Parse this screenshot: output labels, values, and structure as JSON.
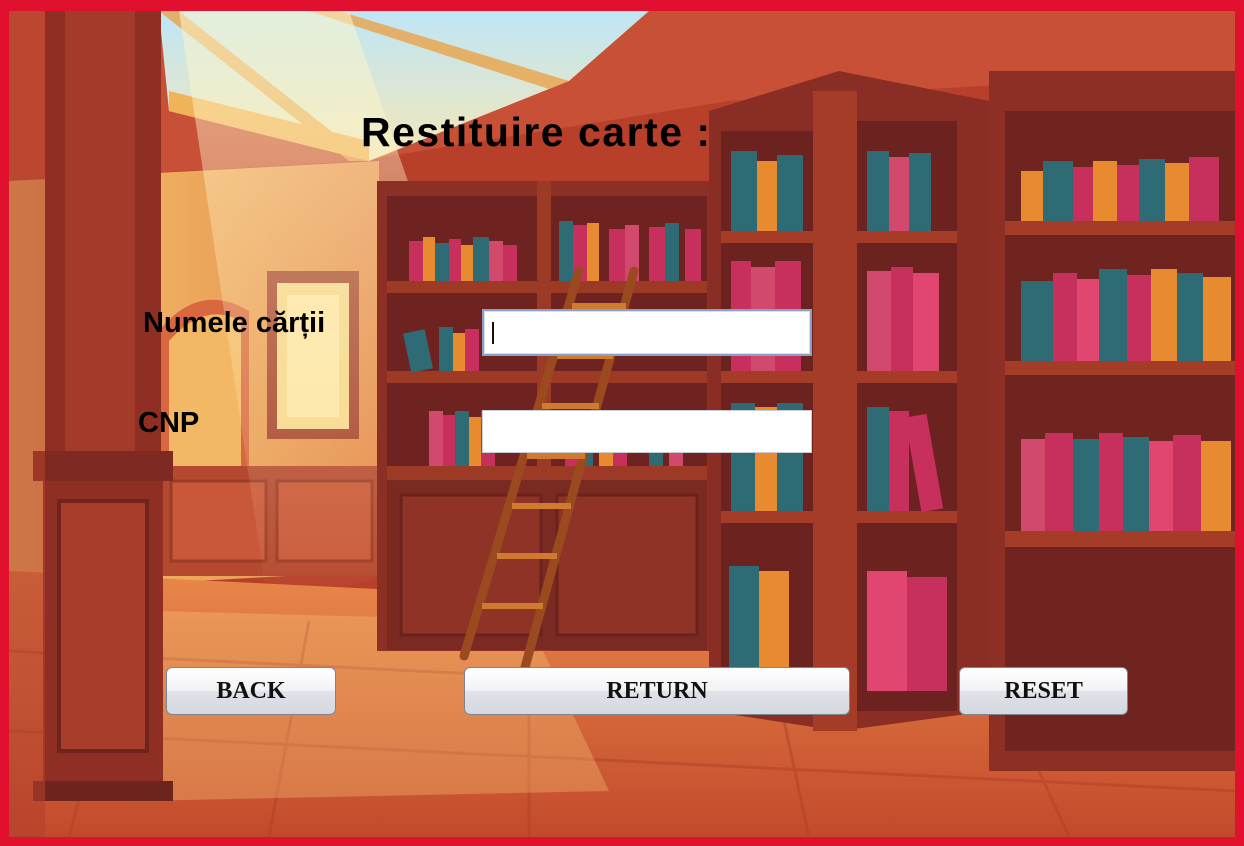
{
  "window": {
    "title": "Restituire carte :"
  },
  "form": {
    "book_name": {
      "label": "Numele cărții",
      "value": ""
    },
    "cnp": {
      "label": "CNP",
      "value": ""
    }
  },
  "buttons": {
    "back_label": "BACK",
    "return_label": "RETURN",
    "reset_label": "RESET"
  },
  "colors": {
    "frame_border": "#e0102e",
    "background_theme": "#c9472b"
  }
}
